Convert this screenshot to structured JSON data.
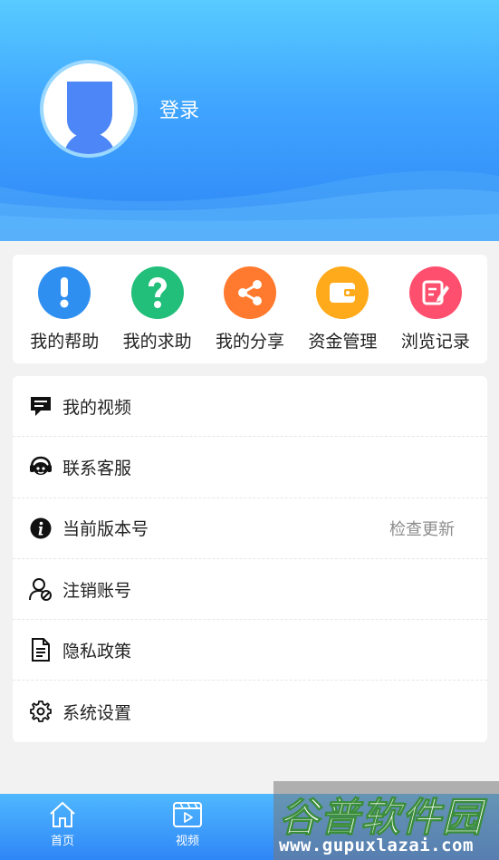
{
  "header": {
    "login_label": "登录",
    "avatar_icon": "default-user-avatar"
  },
  "shortcuts": [
    {
      "label": "我的帮助",
      "icon": "exclamation-icon",
      "color": "#2f8ff0"
    },
    {
      "label": "我的求助",
      "icon": "question-icon",
      "color": "#22bf7a"
    },
    {
      "label": "我的分享",
      "icon": "share-icon",
      "color": "#ff7a2e"
    },
    {
      "label": "资金管理",
      "icon": "wallet-icon",
      "color": "#ffaa1a"
    },
    {
      "label": "浏览记录",
      "icon": "edit-note-icon",
      "color": "#ff4f6e"
    }
  ],
  "menu": [
    {
      "label": "我的视频",
      "icon": "message-icon",
      "extra": ""
    },
    {
      "label": "联系客服",
      "icon": "headset-icon",
      "extra": ""
    },
    {
      "label": "当前版本号",
      "icon": "info-icon",
      "extra": "检查更新"
    },
    {
      "label": "注销账号",
      "icon": "user-cancel-icon",
      "extra": ""
    },
    {
      "label": "隐私政策",
      "icon": "document-icon",
      "extra": ""
    },
    {
      "label": "系统设置",
      "icon": "gear-icon",
      "extra": ""
    }
  ],
  "tabbar": [
    {
      "label": "首页",
      "icon": "home-icon"
    },
    {
      "label": "视频",
      "icon": "video-icon"
    }
  ],
  "watermark": {
    "title": "谷普软件园",
    "url": "www.gupuxlazai.com"
  }
}
